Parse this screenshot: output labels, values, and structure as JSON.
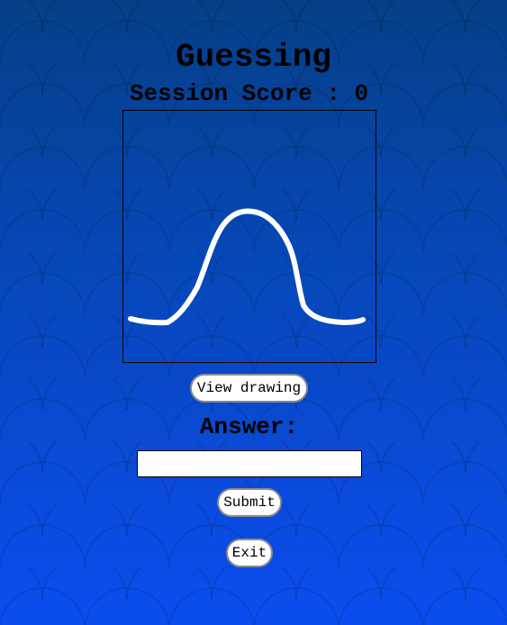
{
  "page": {
    "title": "Guessing",
    "score_label": "Session Score",
    "score_separator": ":",
    "score_value": "0"
  },
  "drawing": {
    "stroke_color": "#ffffff",
    "shape": "bell-curve"
  },
  "actions": {
    "view_drawing_label": "View drawing",
    "submit_label": "Submit",
    "exit_label": "Exit"
  },
  "answer": {
    "label": "Answer:",
    "value": "",
    "placeholder": ""
  },
  "colors": {
    "background_top": "#053f86",
    "background_bottom": "#0b4cf0",
    "button_fill": "#ffffff",
    "button_border": "#8a8a8a"
  }
}
